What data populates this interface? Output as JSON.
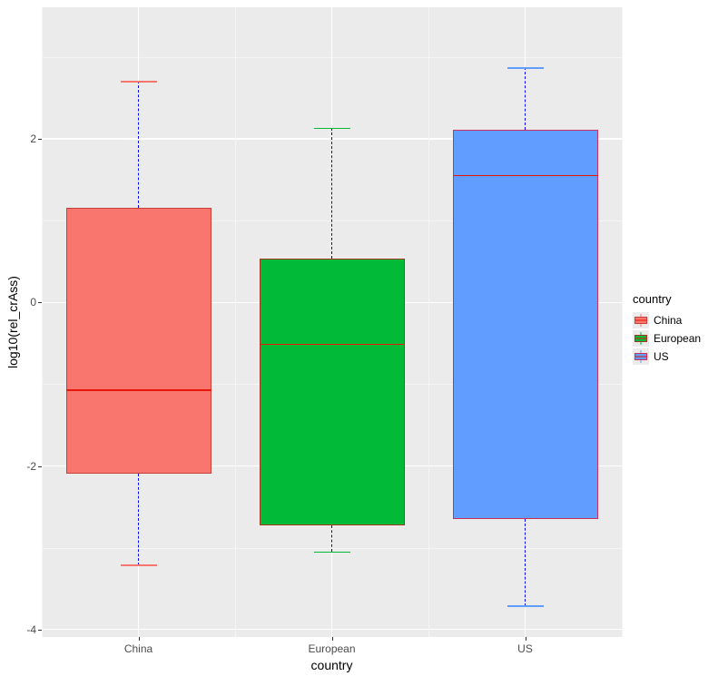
{
  "chart_data": {
    "type": "boxplot",
    "xlabel": "country",
    "ylabel": "log10(rel_crAss)",
    "ylim": [
      -4.5,
      3.2
    ],
    "y_ticks": [
      -4,
      -2,
      0,
      2
    ],
    "categories": [
      "China",
      "European",
      "US"
    ],
    "series": [
      {
        "name": "China",
        "color": "#f8766d",
        "min": -3.22,
        "q1": -2.1,
        "median": -1.08,
        "q3": 1.15,
        "max": 2.7
      },
      {
        "name": "European",
        "color": "#00ba38",
        "min": -3.06,
        "q1": -2.73,
        "median": -0.52,
        "q3": 0.53,
        "max": 2.13
      },
      {
        "name": "US",
        "color": "#619cff",
        "min": -3.72,
        "q1": -2.66,
        "median": 1.54,
        "q3": 2.1,
        "max": 2.87
      }
    ],
    "legend_title": "country"
  },
  "ui": {
    "xlabel": "country",
    "ylabel": "log10(rel_crAss)",
    "legend_title": "country",
    "y_ticks": {
      "0": "-4",
      "1": "-2",
      "2": "0",
      "3": "2"
    },
    "x_ticks": {
      "0": "China",
      "1": "European",
      "2": "US"
    },
    "legend": {
      "0": "China",
      "1": "European",
      "2": "US"
    }
  }
}
